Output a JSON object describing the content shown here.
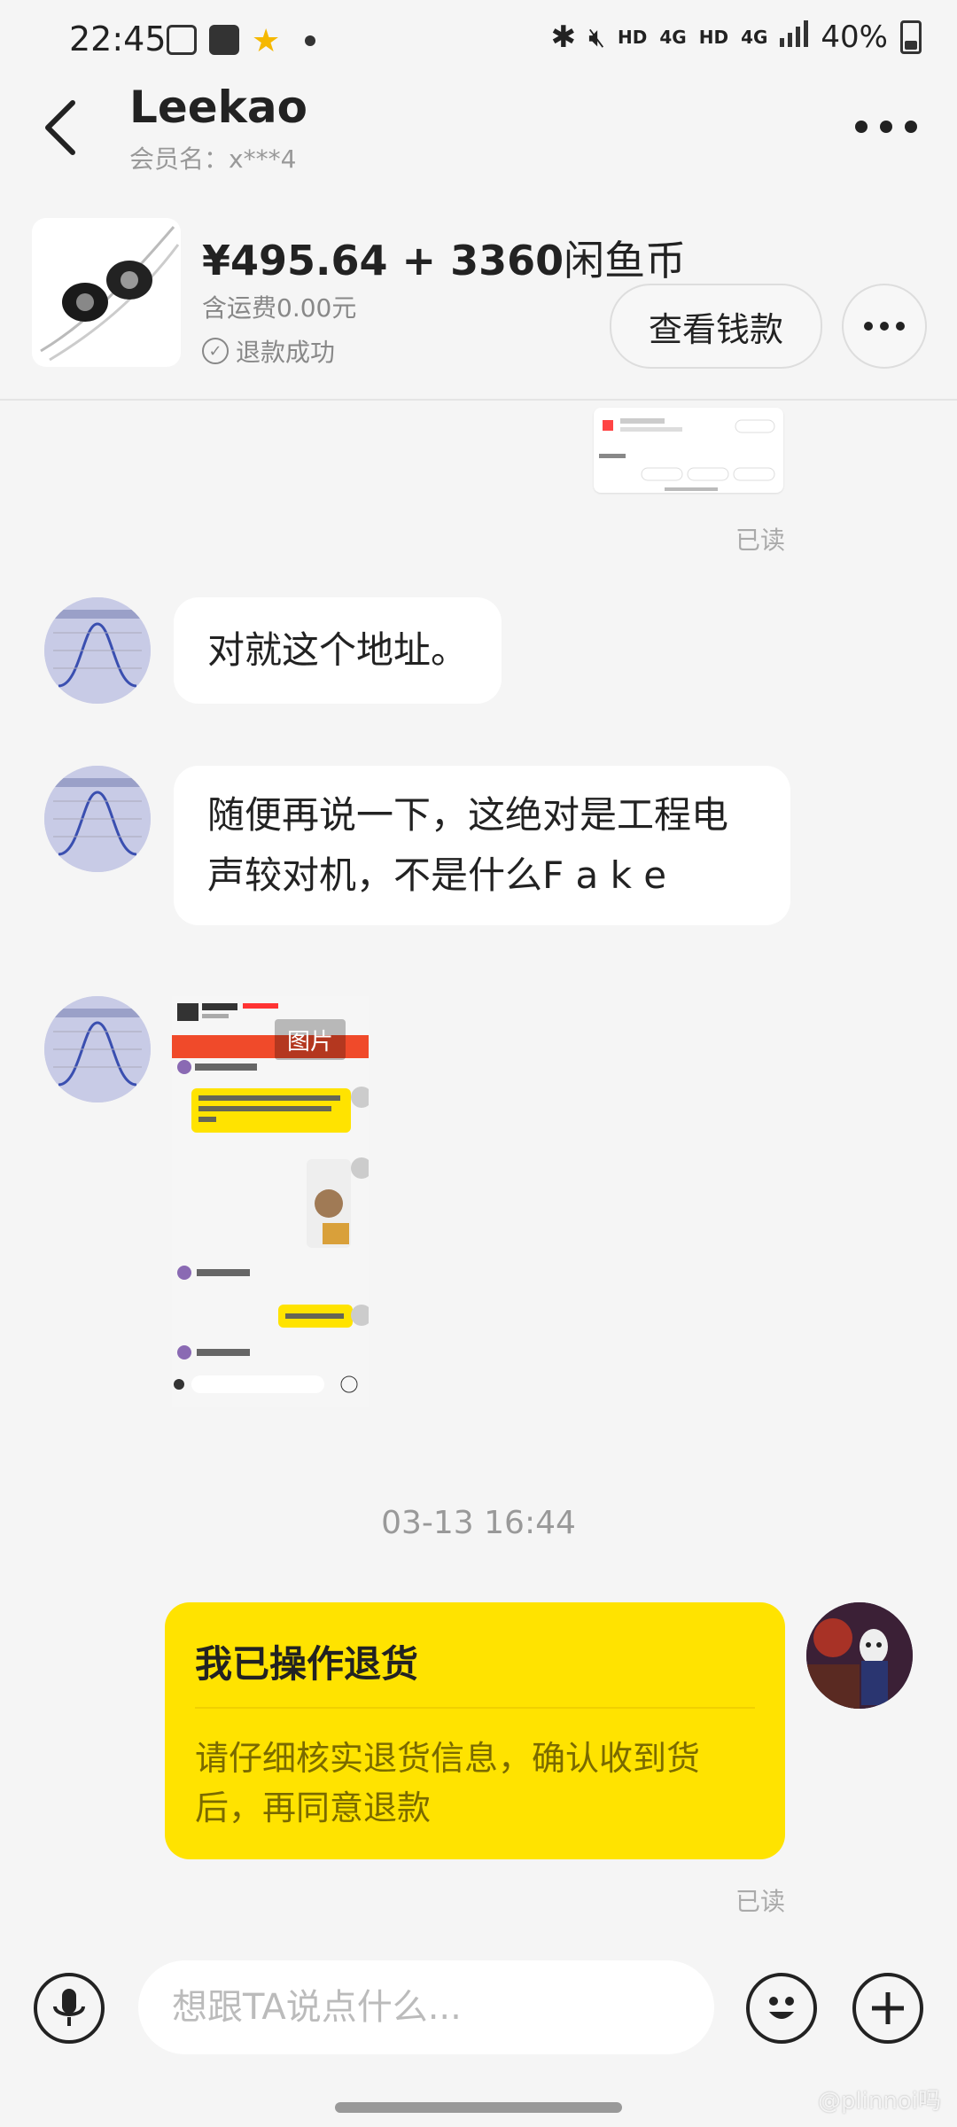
{
  "status_bar": {
    "time": "22:45",
    "hd1": "HD",
    "net1": "4G",
    "hd2": "HD",
    "net2": "4G",
    "battery": "40%"
  },
  "header": {
    "title": "Leekao",
    "member": "会员名：x***4"
  },
  "product": {
    "price": "¥495.64 + 3360",
    "price_suffix": "闲鱼币",
    "shipping": "含运费0.00元",
    "status": "退款成功",
    "view_button": "查看钱款"
  },
  "messages": {
    "read1": "已读",
    "msg1": "对就这个地址。",
    "msg2": "随便再说一下，这绝对是工程电声较对机，不是什么F a k e",
    "image_badge": "图片",
    "timestamp": "03-13 16:44",
    "card_title": "我已操作退货",
    "card_body": "请仔细核实退货信息，确认收到货后，再同意退款",
    "read2": "已读"
  },
  "input": {
    "placeholder": "想跟TA说点什么..."
  },
  "watermark": "@plinnoi吗"
}
